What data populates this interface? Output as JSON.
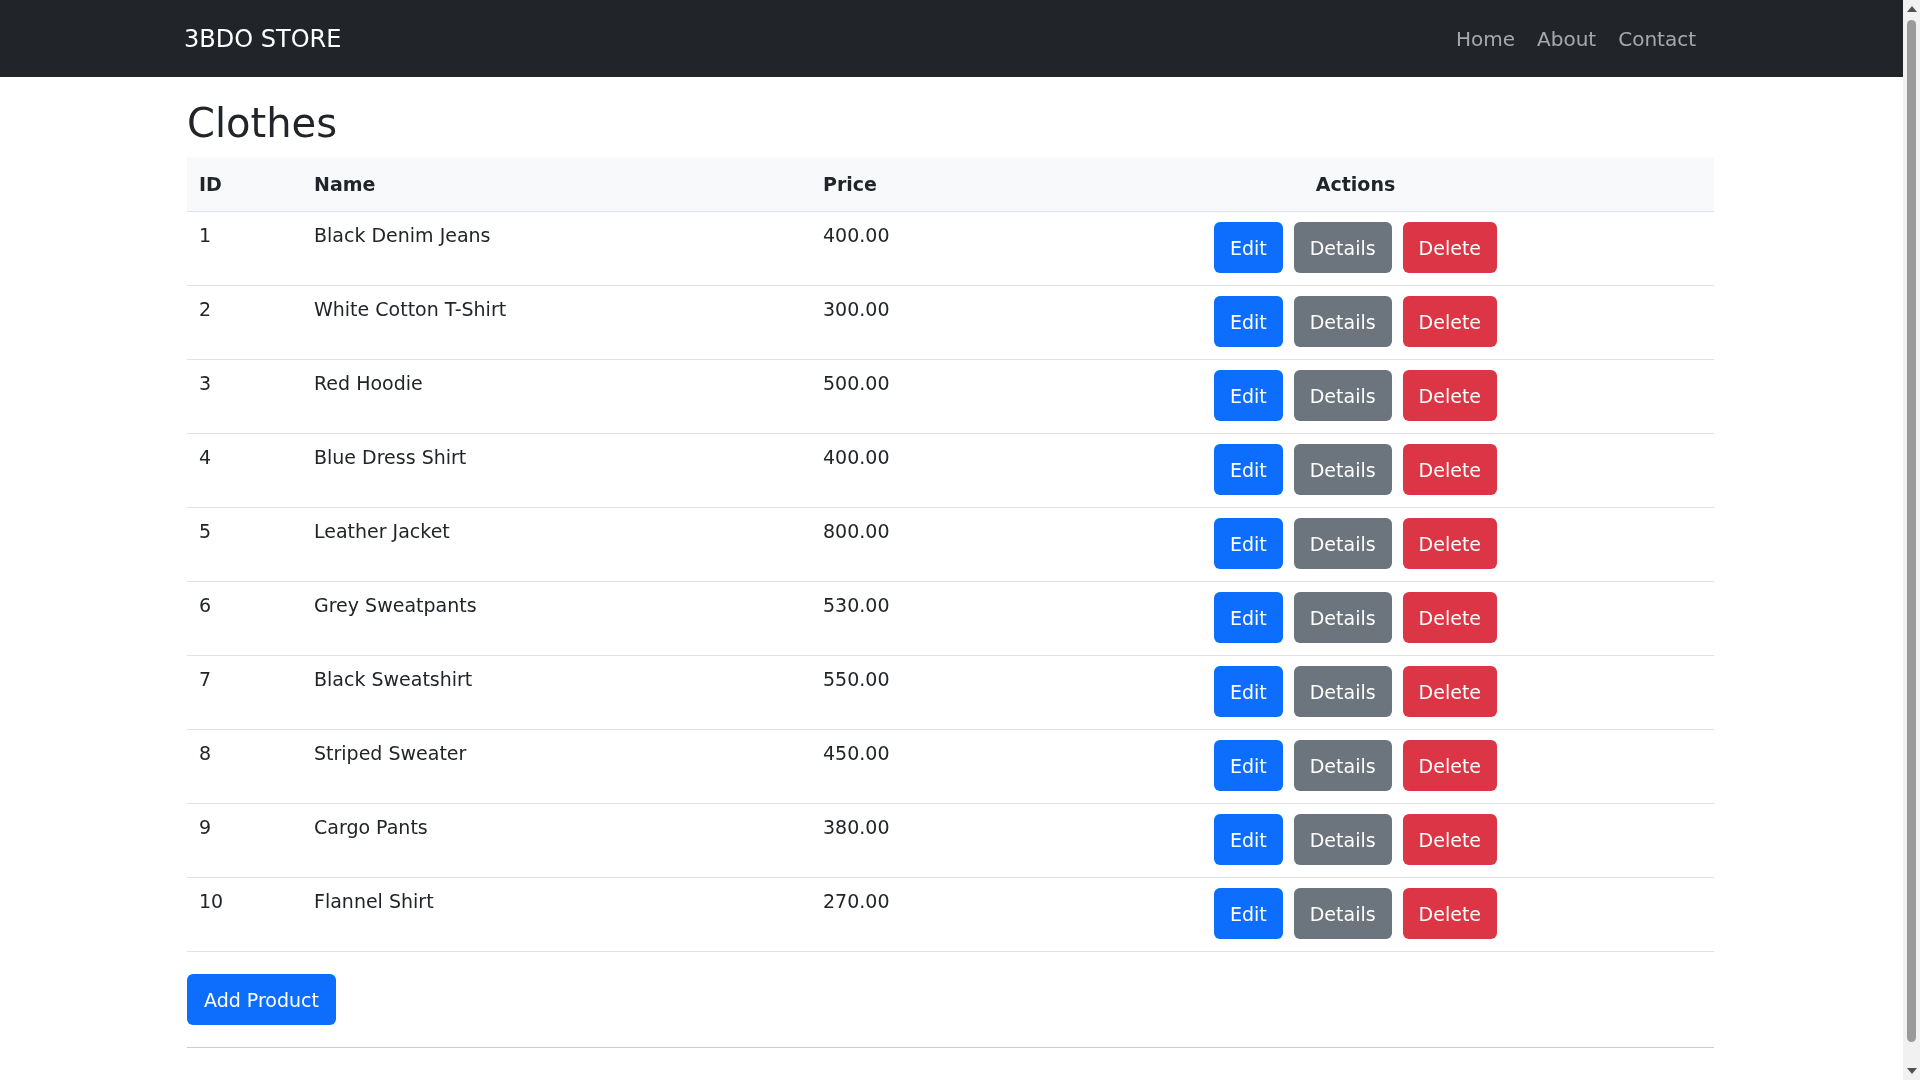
{
  "navbar": {
    "brand": "3BDO STORE",
    "links": [
      "Home",
      "About",
      "Contact"
    ]
  },
  "heading": "Clothes",
  "table": {
    "columns": [
      "ID",
      "Name",
      "Price",
      "Actions"
    ],
    "rows": [
      {
        "id": "1",
        "name": "Black Denim Jeans",
        "price": "400.00",
        "actions": [
          "Edit",
          "Details",
          "Delete"
        ]
      },
      {
        "id": "2",
        "name": "White Cotton T-Shirt",
        "price": "300.00",
        "actions": [
          "Edit",
          "Details",
          "Delete"
        ]
      },
      {
        "id": "3",
        "name": "Red Hoodie",
        "price": "500.00",
        "actions": [
          "Edit",
          "Details",
          "Delete"
        ]
      },
      {
        "id": "4",
        "name": "Blue Dress Shirt",
        "price": "400.00",
        "actions": [
          "Edit",
          "Details",
          "Delete"
        ]
      },
      {
        "id": "5",
        "name": "Leather Jacket",
        "price": "800.00",
        "actions": [
          "Edit",
          "Details",
          "Delete"
        ]
      },
      {
        "id": "6",
        "name": "Grey Sweatpants",
        "price": "530.00",
        "actions": [
          "Edit",
          "Details",
          "Delete"
        ]
      },
      {
        "id": "7",
        "name": "Black Sweatshirt",
        "price": "550.00",
        "actions": [
          "Edit",
          "Details",
          "Delete"
        ]
      },
      {
        "id": "8",
        "name": "Striped Sweater",
        "price": "450.00",
        "actions": [
          "Edit",
          "Details",
          "Delete"
        ]
      },
      {
        "id": "9",
        "name": "Cargo Pants",
        "price": "380.00",
        "actions": [
          "Edit",
          "Details",
          "Delete"
        ]
      },
      {
        "id": "10",
        "name": "Flannel Shirt",
        "price": "270.00",
        "actions": [
          "Edit",
          "Details",
          "Delete"
        ]
      }
    ]
  },
  "add_button": "Add Product"
}
